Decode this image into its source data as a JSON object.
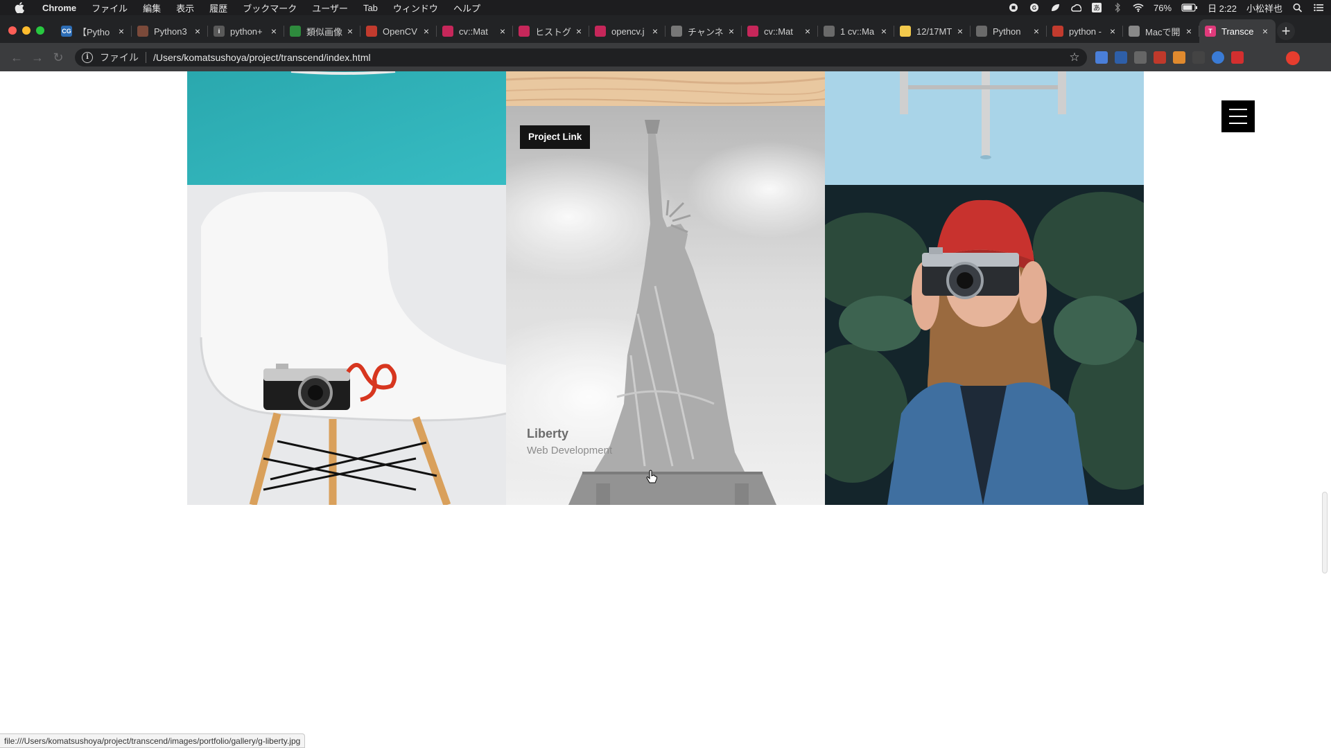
{
  "menubar": {
    "app": "Chrome",
    "items": [
      "ファイル",
      "編集",
      "表示",
      "履歴",
      "ブックマーク",
      "ユーザー",
      "Tab",
      "ウィンドウ",
      "ヘルプ"
    ],
    "battery": "76%",
    "clock": "日 2:22",
    "user": "小松祥也"
  },
  "tabs": [
    {
      "title": "【Pytho",
      "favicon": "CG",
      "color": "#2d6db5"
    },
    {
      "title": "Python3",
      "favicon": "",
      "color": "#7b4a3a"
    },
    {
      "title": "python+",
      "favicon": "i",
      "color": "#5a5a5a"
    },
    {
      "title": "類似画像",
      "favicon": "",
      "color": "#2e8b3d"
    },
    {
      "title": "OpenCV",
      "favicon": "",
      "color": "#c23b2e"
    },
    {
      "title": "cv::Mat",
      "favicon": "",
      "color": "#c6275a"
    },
    {
      "title": "ヒストグ",
      "favicon": "",
      "color": "#c6275a"
    },
    {
      "title": "opencv.j",
      "favicon": "",
      "color": "#c6275a"
    },
    {
      "title": "チャンネ",
      "favicon": "",
      "color": "#777777"
    },
    {
      "title": "cv::Mat",
      "favicon": "",
      "color": "#c6275a"
    },
    {
      "title": "1 cv::Ma",
      "favicon": "",
      "color": "#6a6a6a"
    },
    {
      "title": "12/17MT",
      "favicon": "",
      "color": "#f2c94c"
    },
    {
      "title": "Python",
      "favicon": "",
      "color": "#6a6a6a"
    },
    {
      "title": "python -",
      "favicon": "",
      "color": "#c23b2e"
    },
    {
      "title": "Macで開",
      "favicon": "",
      "color": "#888888"
    },
    {
      "title": "Transce",
      "favicon": "T",
      "color": "#e03a7b",
      "active": true
    }
  ],
  "omnibox": {
    "scheme": "ファイル",
    "url": "/Users/komatsushoya/project/transcend/index.html"
  },
  "page": {
    "project_link": "Project Link",
    "item_title": "Liberty",
    "item_category": "Web Development"
  },
  "status_url": "file:///Users/komatsushoya/project/transcend/images/portfolio/gallery/g-liberty.jpg",
  "colors": {
    "teal": "#2eb1b8",
    "sky": "#a8d3e6",
    "dark_tile": "#15242a"
  }
}
